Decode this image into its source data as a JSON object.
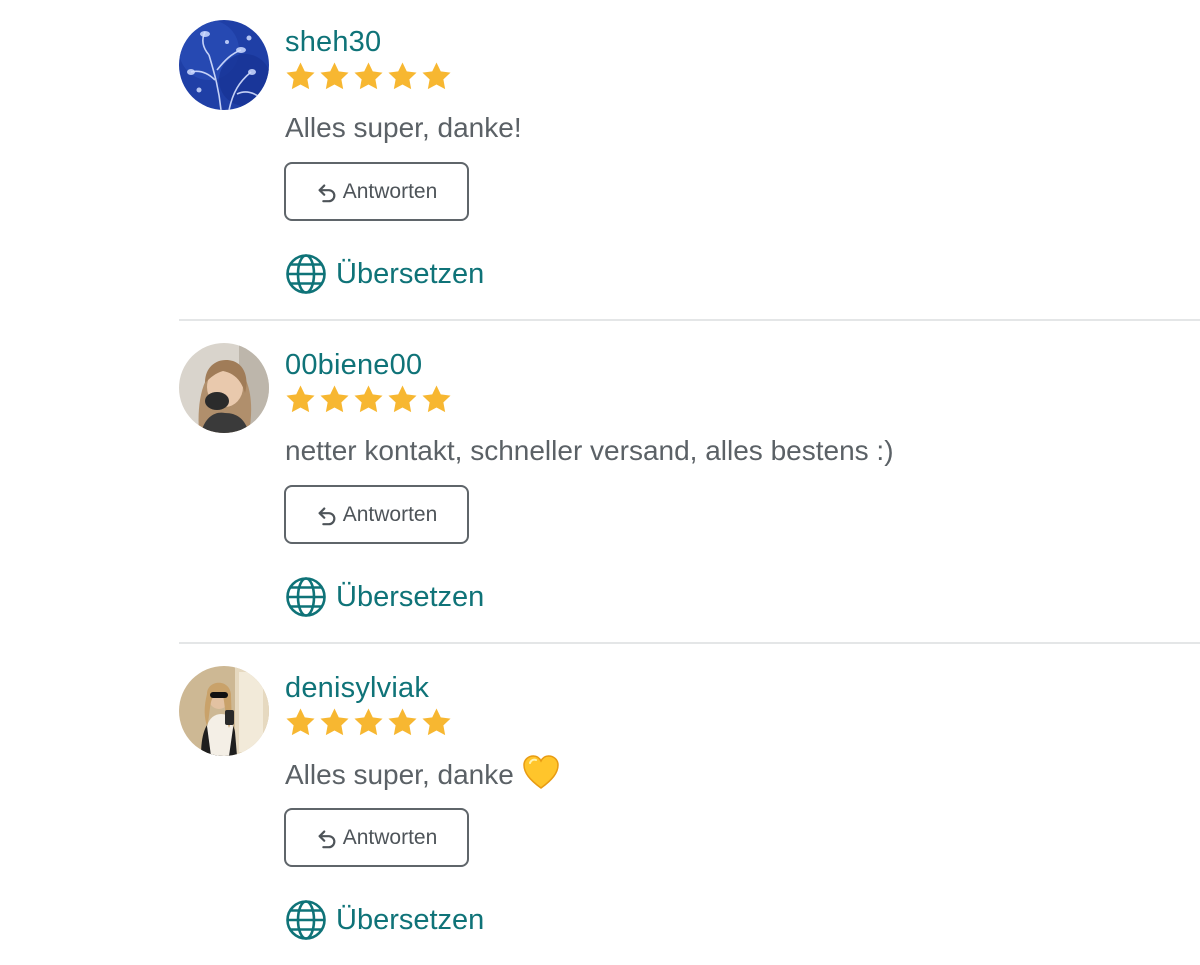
{
  "colors": {
    "accent": "#0f7378",
    "star": "#f7b731",
    "text": "#5b6166",
    "border": "#5f656a",
    "divider": "#e4e6e7"
  },
  "reviews": [
    {
      "username": "sheh30",
      "rating": 5,
      "comment": "Alles super, danke!",
      "reply_label": "Antworten",
      "translate_label": "Übersetzen",
      "avatar_icon": "blue-botanical-avatar"
    },
    {
      "username": "00biene00",
      "rating": 5,
      "comment": "netter kontakt, schneller versand, alles bestens :)",
      "reply_label": "Antworten",
      "translate_label": "Übersetzen",
      "avatar_icon": "person-photo-avatar"
    },
    {
      "username": "denisylviak",
      "rating": 5,
      "comment": "Alles super, danke",
      "comment_emoji": "yellow-heart-icon",
      "reply_label": "Antworten",
      "translate_label": "Übersetzen",
      "avatar_icon": "mirror-selfie-avatar"
    }
  ]
}
